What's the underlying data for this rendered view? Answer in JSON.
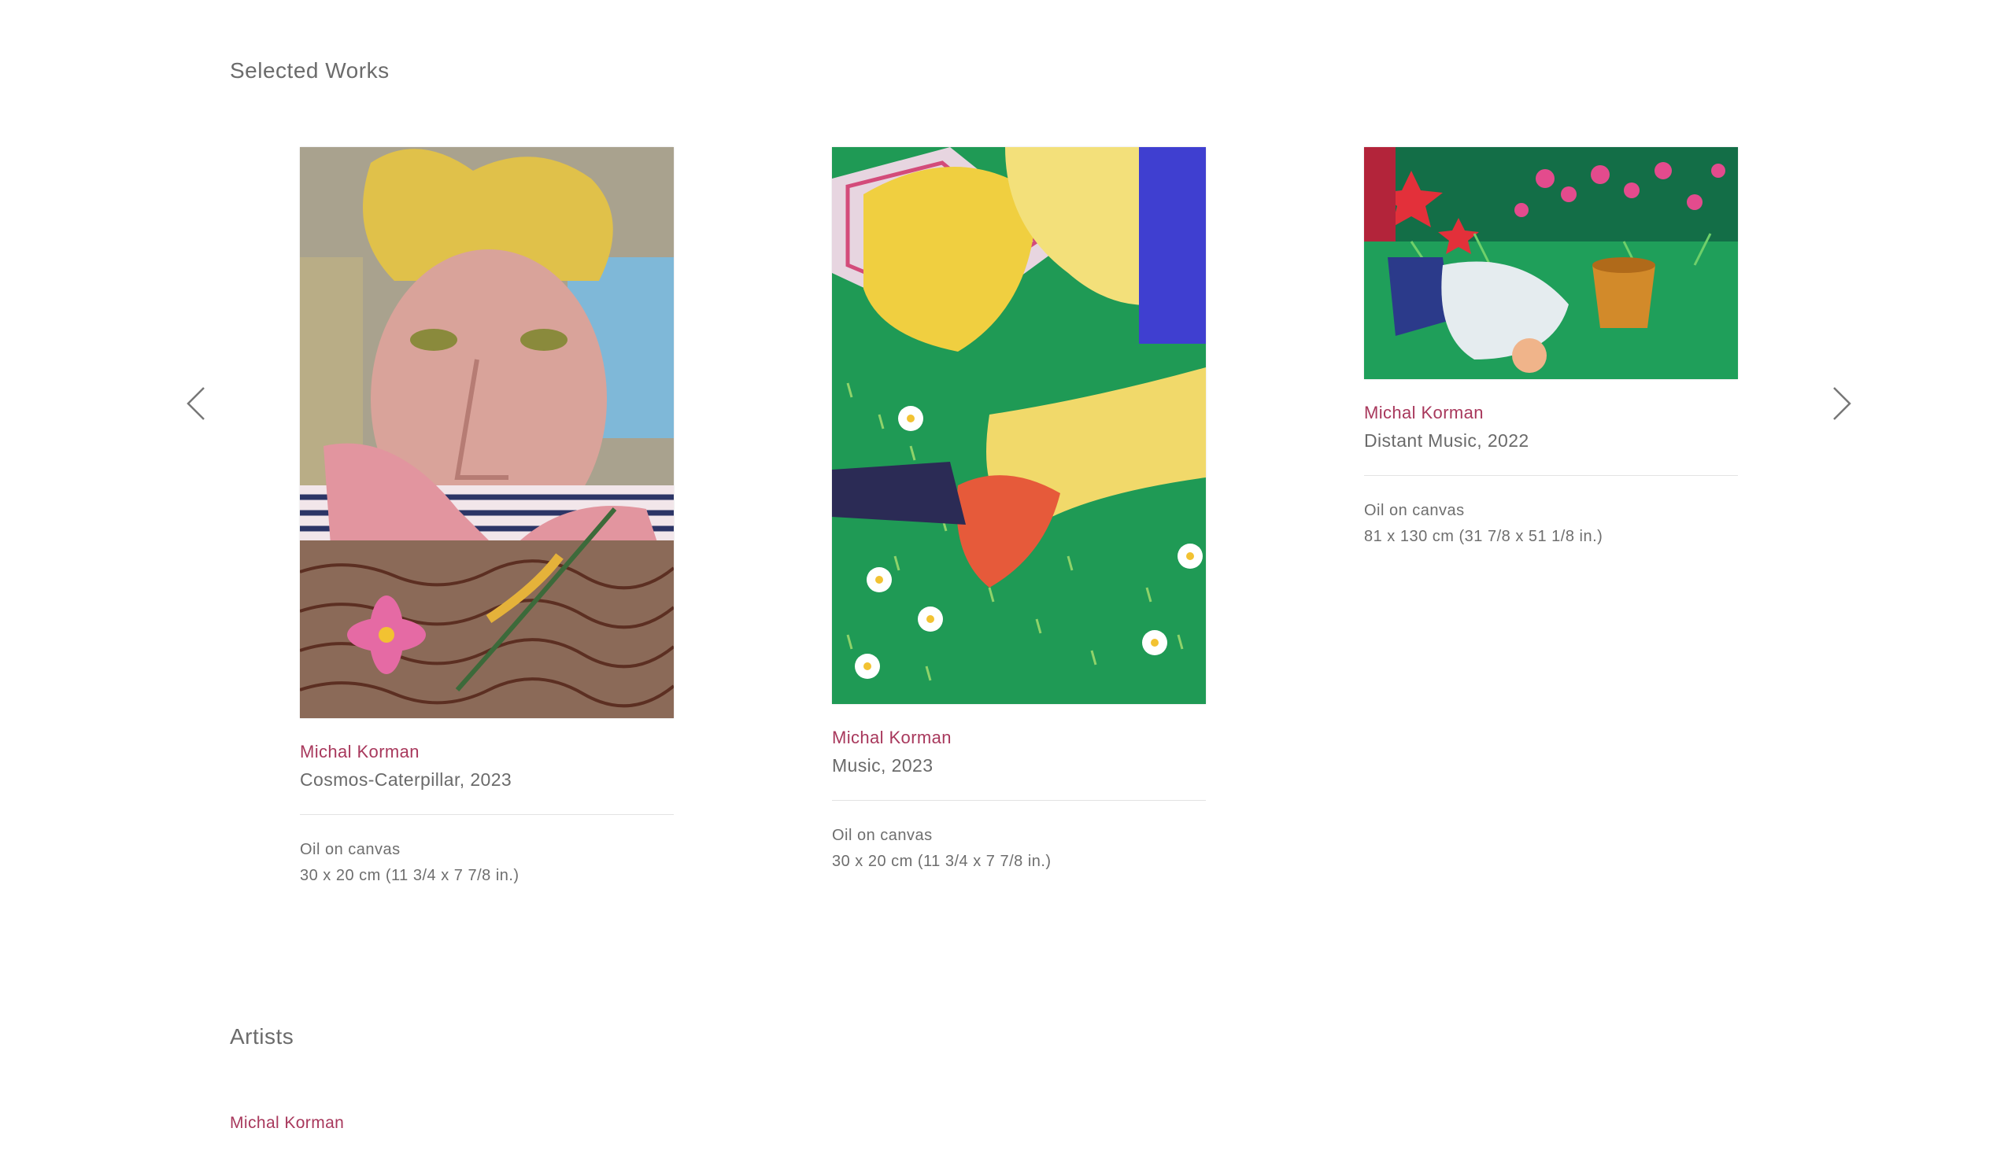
{
  "sections": {
    "selected_works_title": "Selected Works",
    "artists_title": "Artists"
  },
  "carousel": {
    "prev_icon": "chevron-left-icon",
    "next_icon": "chevron-right-icon",
    "works": [
      {
        "artist": "Michal Korman",
        "title": "Cosmos-Caterpillar, 2023",
        "medium": "Oil on canvas",
        "dimensions": "30 x 20 cm (11 3/4 x 7 7/8 in.)"
      },
      {
        "artist": "Michal Korman",
        "title": "Music, 2023",
        "medium": "Oil on canvas",
        "dimensions": "30 x 20 cm (11 3/4 x 7 7/8 in.)"
      },
      {
        "artist": "Michal Korman",
        "title": "Distant Music, 2022",
        "medium": "Oil on canvas",
        "dimensions": "81 x 130 cm (31 7/8 x 51 1/8 in.)"
      }
    ]
  },
  "artists": [
    {
      "name": "Michal Korman"
    }
  ],
  "colors": {
    "accent": "#a8385c",
    "text": "#6a6a6a",
    "divider": "#e3e3e3"
  }
}
